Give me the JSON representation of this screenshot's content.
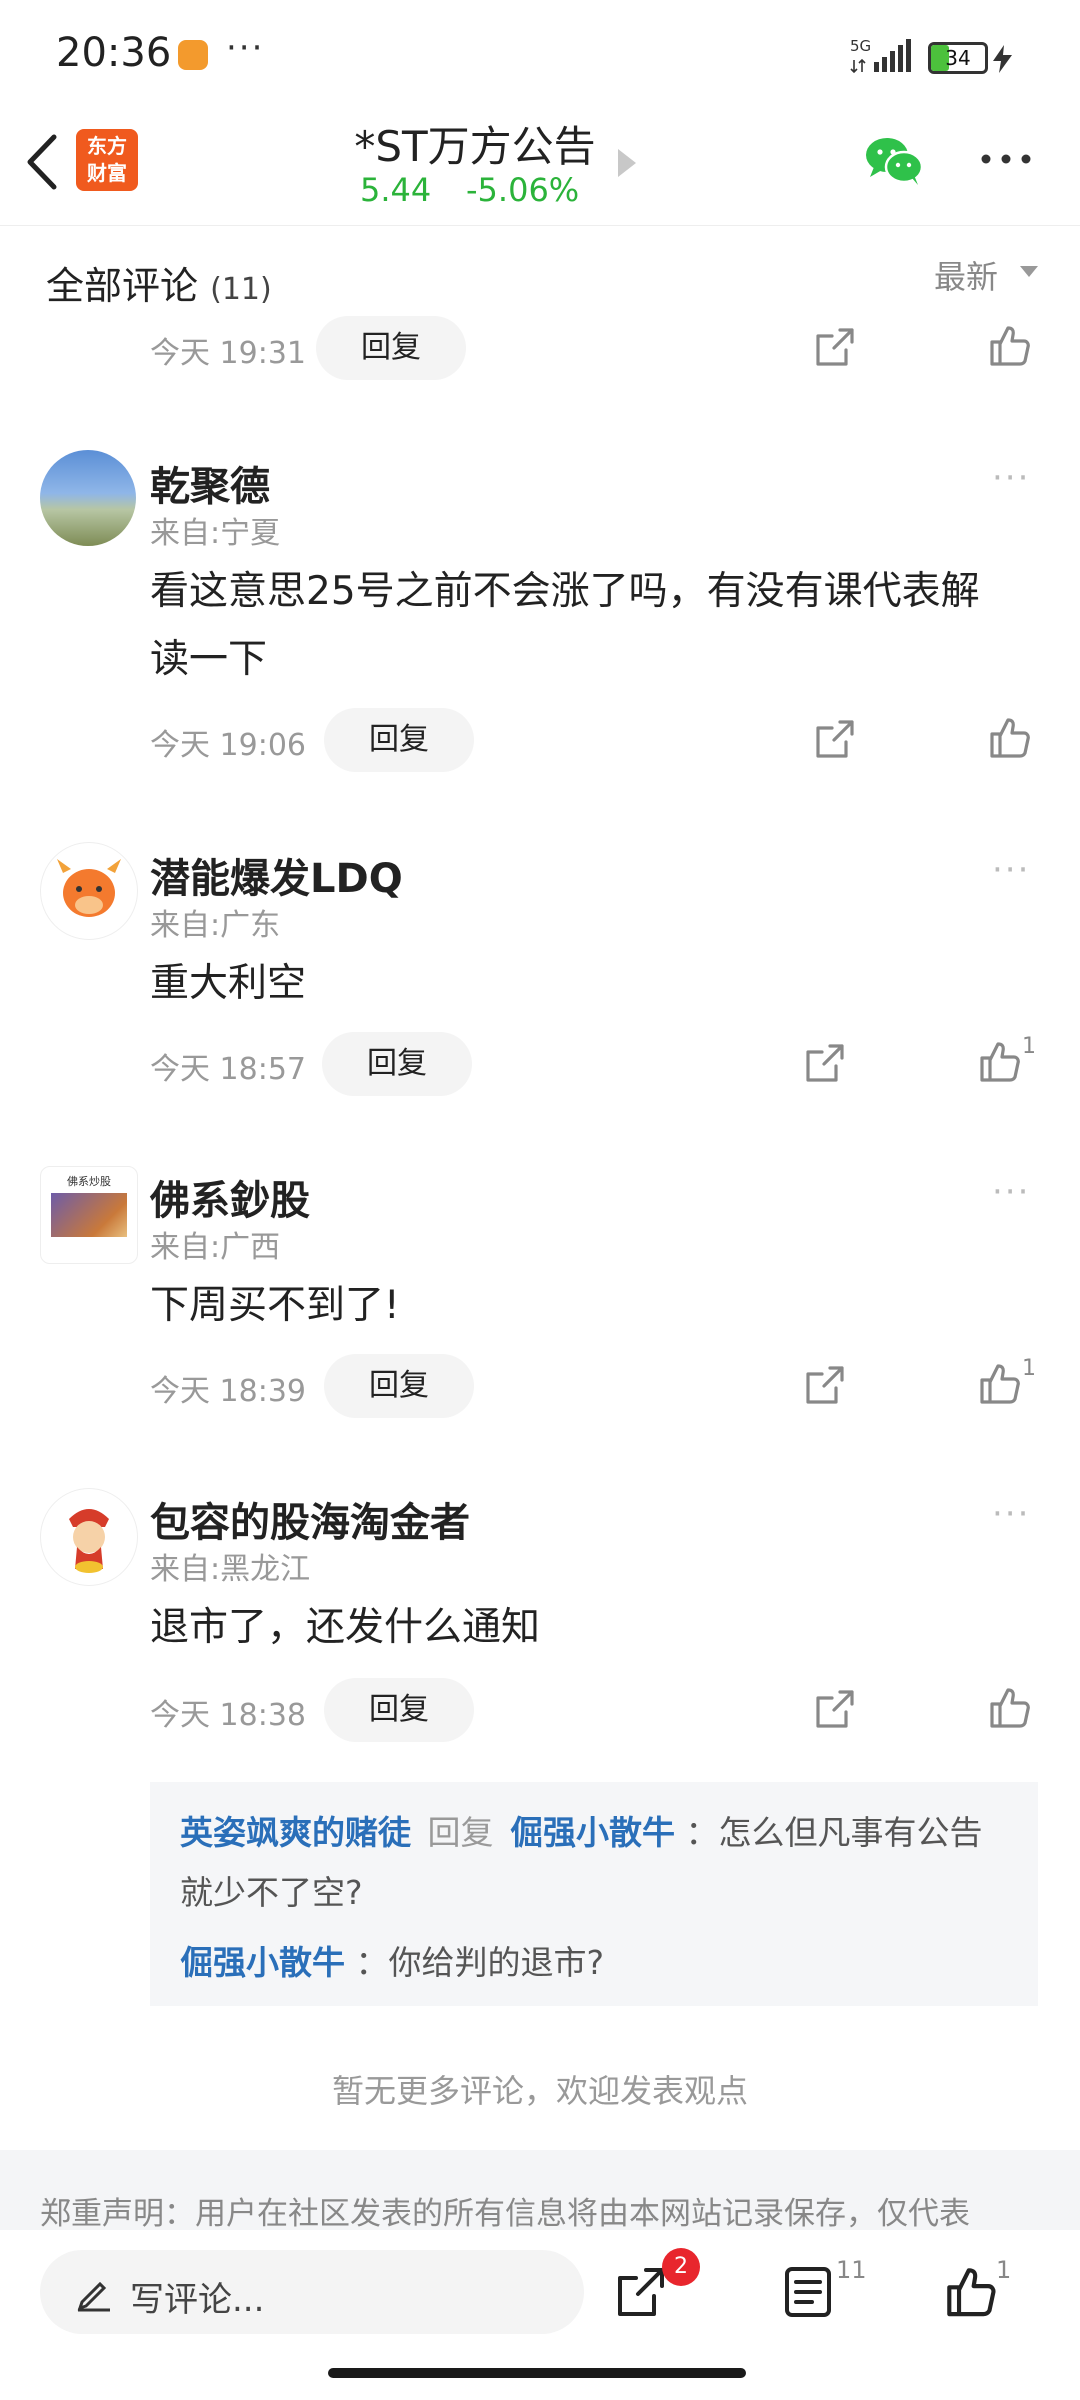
{
  "status_bar": {
    "time": "20:36",
    "more": "···",
    "network": "5G",
    "battery": "34"
  },
  "header": {
    "logo_text_1": "东方",
    "logo_text_2": "财富",
    "title": "*ST万方公告",
    "price": "5.44",
    "change": "-5.06%"
  },
  "comments_header": {
    "title": "全部评论",
    "count": "(11)",
    "sort": "最新"
  },
  "top_row": {
    "time": "今天 19:31",
    "reply": "回复"
  },
  "comments": [
    {
      "name": "乾聚德",
      "location": "来自:宁夏",
      "body_line1": "看这意思25号之前不会涨了吗，有没有课代表解",
      "body_line2": "读一下",
      "time": "今天 19:06",
      "reply": "回复",
      "likes": ""
    },
    {
      "name": "潜能爆发LDQ",
      "location": "来自:广东",
      "body_line1": "重大利空",
      "time": "今天 18:57",
      "reply": "回复",
      "likes": "1"
    },
    {
      "name": "佛系鈔股",
      "location": "来自:广西",
      "body_line1": "下周买不到了!",
      "time": "今天 18:39",
      "reply": "回复",
      "likes": "1"
    },
    {
      "name": "包容的股海淘金者",
      "location": "来自:黑龙江",
      "body_line1": "退市了，还发什么通知",
      "time": "今天 18:38",
      "reply": "回复",
      "likes": ""
    }
  ],
  "nested_replies": {
    "reply1_user": "英姿飒爽的赌徒",
    "reply1_word": "回复",
    "reply1_target": "倔强小散牛",
    "reply1_text_a": "：怎么但凡事有公告",
    "reply1_text_b": "就少不了空?",
    "reply2_user": "倔强小散牛",
    "reply2_text": "：你给判的退市?"
  },
  "avatar3_caption": "佛系炒股",
  "no_more_text": "暂无更多评论，欢迎发表观点",
  "disclaimer": "郑重声明：用户在社区发表的所有信息将由本网站记录保存，仅代表",
  "bottom_bar": {
    "comment_placeholder": "写评论...",
    "share_badge": "2",
    "comments_count": "11",
    "likes_count": "1"
  }
}
